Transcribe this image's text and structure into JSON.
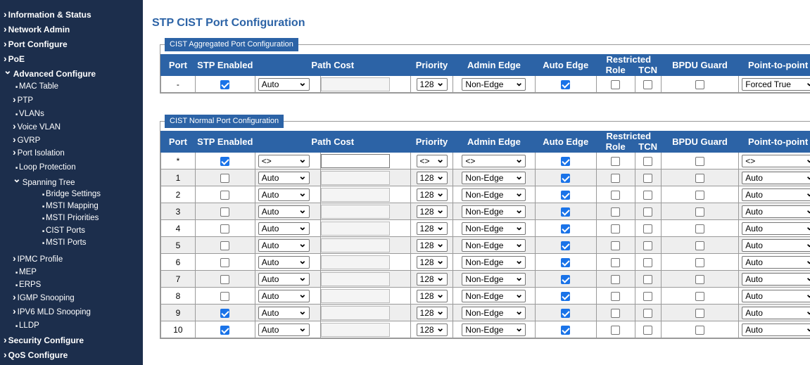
{
  "sidebar": {
    "items": [
      {
        "label": "Information & Status",
        "level": 0,
        "glyph": "chevron-right"
      },
      {
        "label": "Network Admin",
        "level": 0,
        "glyph": "chevron-right"
      },
      {
        "label": "Port Configure",
        "level": 0,
        "glyph": "chevron-right"
      },
      {
        "label": "PoE",
        "level": 0,
        "glyph": "chevron-right"
      },
      {
        "label": "Advanced Configure",
        "level": 0,
        "glyph": "chevron-down"
      },
      {
        "label": "MAC Table",
        "level": 1,
        "glyph": "bullet"
      },
      {
        "label": "PTP",
        "level": 1,
        "glyph": "chevron-right"
      },
      {
        "label": "VLANs",
        "level": 1,
        "glyph": "bullet"
      },
      {
        "label": "Voice VLAN",
        "level": 1,
        "glyph": "chevron-right"
      },
      {
        "label": "GVRP",
        "level": 1,
        "glyph": "chevron-right"
      },
      {
        "label": "Port Isolation",
        "level": 1,
        "glyph": "chevron-right"
      },
      {
        "label": "Loop Protection",
        "level": 1,
        "glyph": "bullet"
      },
      {
        "label": "Spanning Tree",
        "level": 1,
        "glyph": "chevron-down"
      },
      {
        "label": "Bridge Settings",
        "level": 2,
        "glyph": "bullet"
      },
      {
        "label": "MSTI Mapping",
        "level": 2,
        "glyph": "bullet"
      },
      {
        "label": "MSTI Priorities",
        "level": 2,
        "glyph": "bullet"
      },
      {
        "label": "CIST Ports",
        "level": 2,
        "glyph": "bullet"
      },
      {
        "label": "MSTI Ports",
        "level": 2,
        "glyph": "bullet"
      },
      {
        "label": "IPMC Profile",
        "level": 1,
        "glyph": "chevron-right"
      },
      {
        "label": "MEP",
        "level": 1,
        "glyph": "bullet"
      },
      {
        "label": "ERPS",
        "level": 1,
        "glyph": "bullet"
      },
      {
        "label": "IGMP Snooping",
        "level": 1,
        "glyph": "chevron-right"
      },
      {
        "label": "IPV6 MLD Snooping",
        "level": 1,
        "glyph": "chevron-right"
      },
      {
        "label": "LLDP",
        "level": 1,
        "glyph": "bullet"
      },
      {
        "label": "Security Configure",
        "level": 0,
        "glyph": "chevron-right"
      },
      {
        "label": "QoS Configure",
        "level": 0,
        "glyph": "chevron-right"
      }
    ]
  },
  "page": {
    "title": "STP CIST Port Configuration"
  },
  "headers": {
    "port": "Port",
    "stp_enabled": "STP Enabled",
    "path_cost": "Path Cost",
    "priority": "Priority",
    "admin_edge": "Admin Edge",
    "auto_edge": "Auto Edge",
    "restricted": "Restricted",
    "role": "Role",
    "tcn": "TCN",
    "bpdu_guard": "BPDU Guard",
    "point_to_point": "Point-to-point"
  },
  "aggregated": {
    "legend": "CIST Aggregated Port Configuration",
    "row": {
      "port": "-",
      "stp": true,
      "path_cost": "Auto",
      "path_cost_value": "",
      "priority": "128",
      "admin_edge": "Non-Edge",
      "auto_edge": true,
      "role": false,
      "tcn": false,
      "bpdu": false,
      "p2p": "Forced True"
    }
  },
  "normal": {
    "legend": "CIST Normal Port Configuration",
    "rows": [
      {
        "port": "*",
        "stp": true,
        "path_cost": "<>",
        "priority": "<>",
        "admin_edge": "<>",
        "auto_edge": true,
        "role": false,
        "tcn": false,
        "bpdu": false,
        "p2p": "<>"
      },
      {
        "port": "1",
        "stp": false,
        "path_cost": "Auto",
        "priority": "128",
        "admin_edge": "Non-Edge",
        "auto_edge": true,
        "role": false,
        "tcn": false,
        "bpdu": false,
        "p2p": "Auto"
      },
      {
        "port": "2",
        "stp": false,
        "path_cost": "Auto",
        "priority": "128",
        "admin_edge": "Non-Edge",
        "auto_edge": true,
        "role": false,
        "tcn": false,
        "bpdu": false,
        "p2p": "Auto"
      },
      {
        "port": "3",
        "stp": false,
        "path_cost": "Auto",
        "priority": "128",
        "admin_edge": "Non-Edge",
        "auto_edge": true,
        "role": false,
        "tcn": false,
        "bpdu": false,
        "p2p": "Auto"
      },
      {
        "port": "4",
        "stp": false,
        "path_cost": "Auto",
        "priority": "128",
        "admin_edge": "Non-Edge",
        "auto_edge": true,
        "role": false,
        "tcn": false,
        "bpdu": false,
        "p2p": "Auto"
      },
      {
        "port": "5",
        "stp": false,
        "path_cost": "Auto",
        "priority": "128",
        "admin_edge": "Non-Edge",
        "auto_edge": true,
        "role": false,
        "tcn": false,
        "bpdu": false,
        "p2p": "Auto"
      },
      {
        "port": "6",
        "stp": false,
        "path_cost": "Auto",
        "priority": "128",
        "admin_edge": "Non-Edge",
        "auto_edge": true,
        "role": false,
        "tcn": false,
        "bpdu": false,
        "p2p": "Auto"
      },
      {
        "port": "7",
        "stp": false,
        "path_cost": "Auto",
        "priority": "128",
        "admin_edge": "Non-Edge",
        "auto_edge": true,
        "role": false,
        "tcn": false,
        "bpdu": false,
        "p2p": "Auto"
      },
      {
        "port": "8",
        "stp": false,
        "path_cost": "Auto",
        "priority": "128",
        "admin_edge": "Non-Edge",
        "auto_edge": true,
        "role": false,
        "tcn": false,
        "bpdu": false,
        "p2p": "Auto"
      },
      {
        "port": "9",
        "stp": true,
        "path_cost": "Auto",
        "priority": "128",
        "admin_edge": "Non-Edge",
        "auto_edge": true,
        "role": false,
        "tcn": false,
        "bpdu": false,
        "p2p": "Auto"
      },
      {
        "port": "10",
        "stp": true,
        "path_cost": "Auto",
        "priority": "128",
        "admin_edge": "Non-Edge",
        "auto_edge": true,
        "role": false,
        "tcn": false,
        "bpdu": false,
        "p2p": "Auto"
      }
    ]
  },
  "colors": {
    "sidebar_bg": "#1c2e4c",
    "header_bg": "#2c63a6",
    "title": "#2c63a6",
    "checkbox_on": "#1a73e8",
    "row_alt": "#eeeeee"
  }
}
